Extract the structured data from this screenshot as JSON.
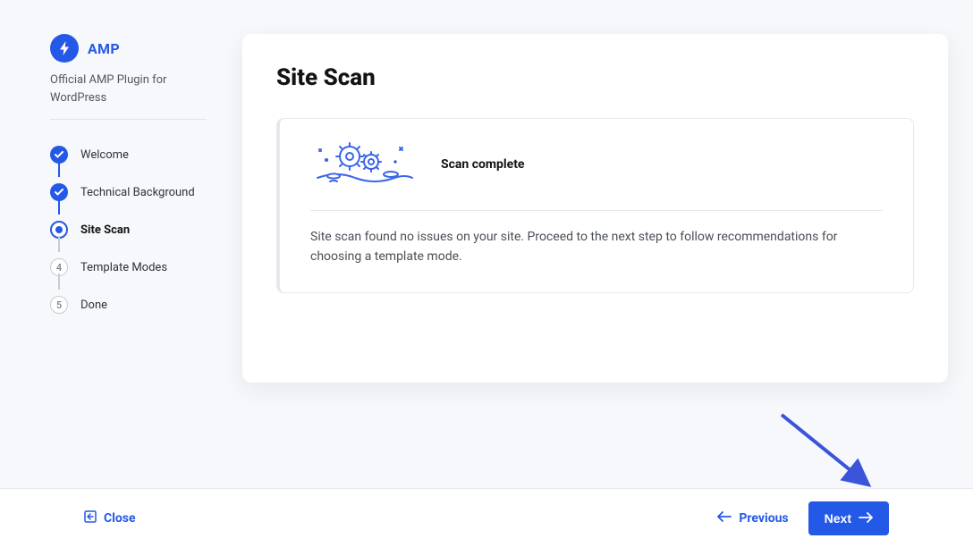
{
  "brand": {
    "name": "AMP",
    "subtitle": "Official AMP Plugin for WordPress"
  },
  "steps": [
    {
      "label": "Welcome",
      "status": "done"
    },
    {
      "label": "Technical Background",
      "status": "done"
    },
    {
      "label": "Site Scan",
      "status": "active"
    },
    {
      "label": "Template Modes",
      "status": "upcoming",
      "num": "4"
    },
    {
      "label": "Done",
      "status": "upcoming",
      "num": "5"
    }
  ],
  "page": {
    "title": "Site Scan",
    "scan_status": "Scan complete",
    "scan_body": "Site scan found no issues on your site. Proceed to the next step to follow recommendations for choosing a template mode."
  },
  "footer": {
    "close": "Close",
    "previous": "Previous",
    "next": "Next"
  }
}
